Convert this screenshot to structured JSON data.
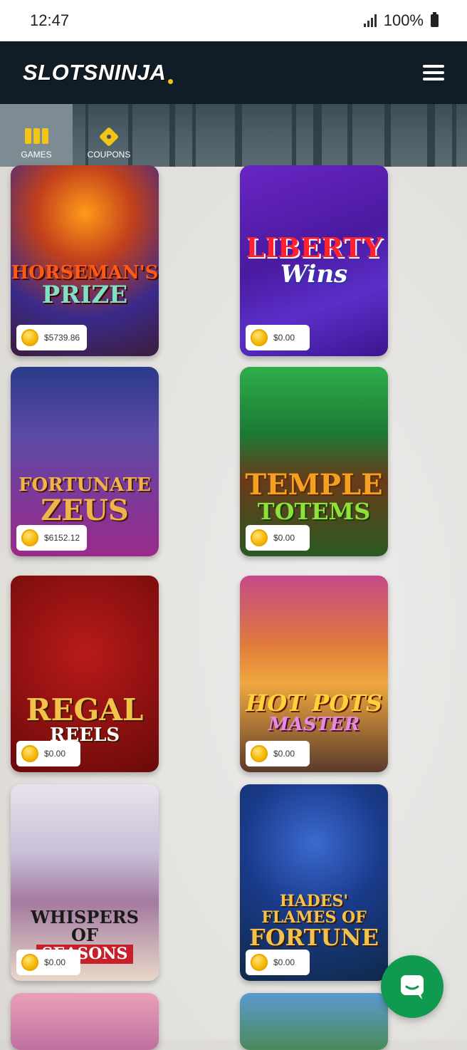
{
  "status_bar": {
    "time": "12:47",
    "battery": "100%"
  },
  "header": {
    "logo": "SLOTSNINJA",
    "menu_icon": "hamburger-menu-icon"
  },
  "nav": {
    "tabs": [
      {
        "label": "GAMES",
        "icon": "games-icon",
        "active": true
      },
      {
        "label": "COUPONS",
        "icon": "coupon-icon",
        "active": false
      }
    ]
  },
  "games": [
    {
      "title_line1": "HORSEMAN'S",
      "title_line2": "PRIZE",
      "price": "$5739.86"
    },
    {
      "title_line1": "LIBERTY",
      "title_line2": "Wins",
      "price": "$0.00"
    },
    {
      "title_line1": "FORTUNATE",
      "title_line2": "ZEUS",
      "price": "$6152.12"
    },
    {
      "title_line1": "TEMPLE",
      "title_line2": "TOTEMS",
      "price": "$0.00"
    },
    {
      "title_line1": "REGAL",
      "title_line2": "REELS",
      "price": "$0.00"
    },
    {
      "title_line1": "HOT POTS",
      "title_line2": "MASTER",
      "price": "$0.00"
    },
    {
      "title_line1": "WHISPERS OF",
      "title_line2": "SEASONS",
      "price": "$0.00"
    },
    {
      "title_line1": "HADES' FLAMES OF",
      "title_line2": "FORTUNE",
      "price": "$0.00"
    }
  ],
  "chat_button": {
    "icon": "chat-icon"
  }
}
